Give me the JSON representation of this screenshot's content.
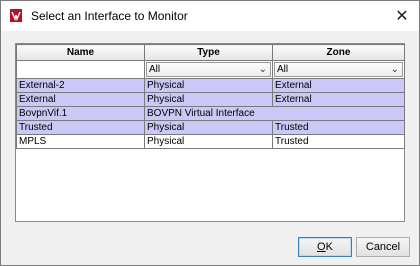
{
  "window": {
    "title": "Select an Interface to Monitor",
    "close_glyph": "✕",
    "app_icon": "watchguard-app-icon"
  },
  "grid": {
    "columns": [
      "Name",
      "Type",
      "Zone"
    ],
    "filters": {
      "name_value": "",
      "type_value": "All",
      "zone_value": "All"
    },
    "rows": [
      {
        "name": "External-2",
        "type": "Physical",
        "zone": "External",
        "selected": true
      },
      {
        "name": "External",
        "type": "Physical",
        "zone": "External",
        "selected": true
      },
      {
        "name": "BovpnVif.1",
        "type": "BOVPN Virtual Interface",
        "zone": "",
        "selected": true
      },
      {
        "name": "Trusted",
        "type": "Physical",
        "zone": "Trusted",
        "selected": true
      },
      {
        "name": "MPLS",
        "type": "Physical",
        "zone": "Trusted",
        "selected": false
      }
    ]
  },
  "buttons": {
    "ok_mnemonic": "O",
    "ok_rest": "K",
    "cancel_label": "Cancel"
  },
  "colors": {
    "selected_row": "#c9c8f7",
    "dialog_bg": "#f0f0f0"
  }
}
